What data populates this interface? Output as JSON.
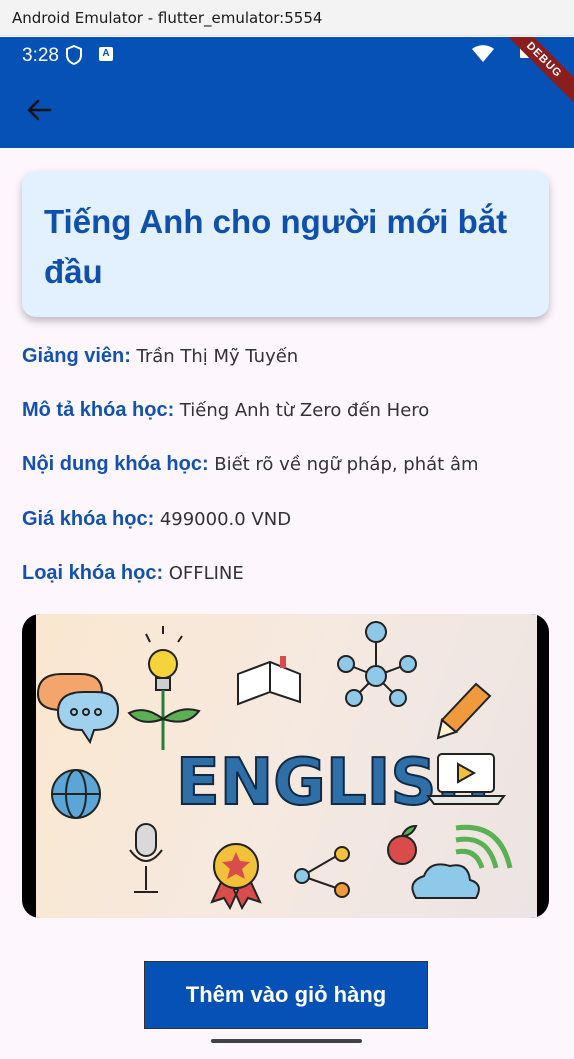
{
  "window": {
    "title": "Android Emulator - flutter_emulator:5554"
  },
  "status_bar": {
    "time": "3:28",
    "a_badge": "A",
    "debug_label": "DEBUG"
  },
  "icons": {
    "back": "arrow-back-icon",
    "shield": "shield-icon",
    "wifi": "wifi-icon",
    "battery": "battery-icon"
  },
  "course": {
    "title": "Tiếng Anh cho người mới bắt đầu",
    "fields": [
      {
        "label": "Giảng viên:",
        "value": "Trần Thị Mỹ Tuyến"
      },
      {
        "label": "Mô tả khóa học:",
        "value": "Tiếng Anh từ Zero đến Hero"
      },
      {
        "label": "Nội dung khóa học:",
        "value": "Biết rõ về ngữ pháp, phát âm"
      },
      {
        "label": "Giá khóa học:",
        "value": "499000.0 VND"
      },
      {
        "label": "Loại khóa học:",
        "value": "OFFLINE"
      }
    ],
    "image_text": "ENGLISH"
  },
  "actions": {
    "add_to_cart_label": "Thêm vào giỏ hàng"
  },
  "colors": {
    "primary": "#0651b6",
    "label": "#1252b1",
    "card_bg": "#e3f0fd",
    "page_bg": "#fdf6fd"
  }
}
